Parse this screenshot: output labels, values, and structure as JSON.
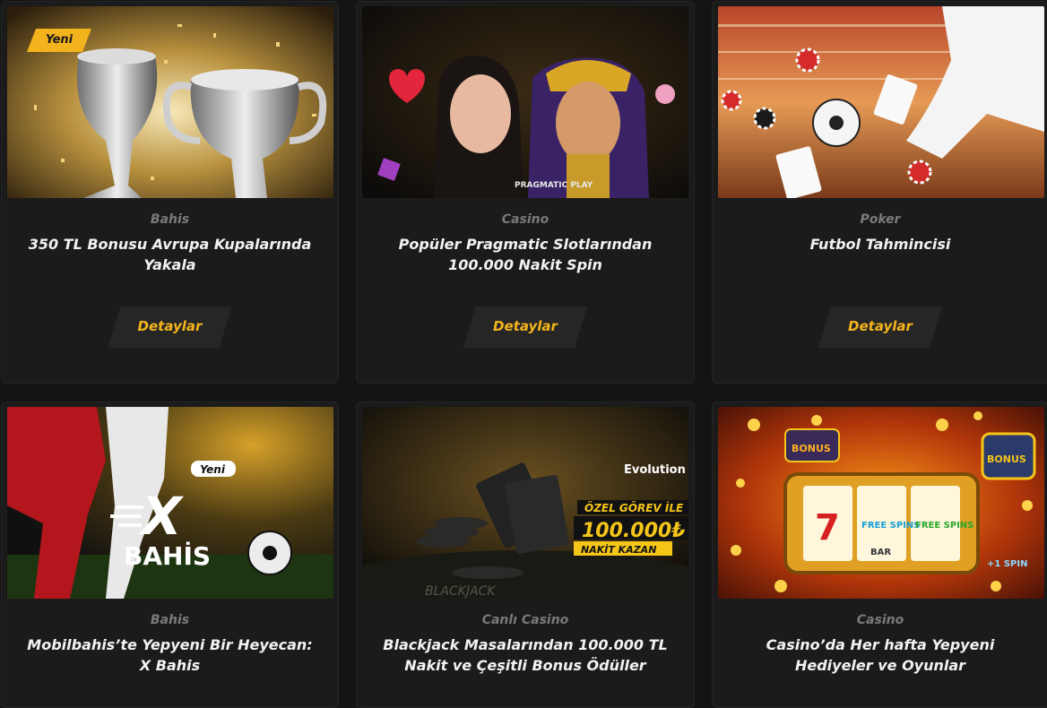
{
  "cards": [
    {
      "category": "Bahis",
      "title": "350 TL Bonusu Avrupa Kupalarında Yakala",
      "button": "Detaylar",
      "badge": "Yeni"
    },
    {
      "category": "Casino",
      "title": "Popüler Pragmatic Slotlarından 100.000 Nakit Spin",
      "button": "Detaylar",
      "image_text": "PRAGMATIC PLAY"
    },
    {
      "category": "Poker",
      "title": "Futbol Tahmincisi",
      "button": "Detaylar"
    },
    {
      "category": "Bahis",
      "title": "Mobilbahis’te Yepyeni Bir Heyecan: X Bahis",
      "image_badge": "Yeni",
      "image_text_x": "X",
      "image_text_bahis": "BAHİS"
    },
    {
      "category": "Canlı Casino",
      "title": "Blackjack Masalarından 100.000 TL Nakit ve Çeşitli Bonus Ödüller",
      "image_brand": "Evolution",
      "image_line1": "ÖZEL GÖREV İLE",
      "image_line2": "100.000₺",
      "image_line3": "NAKİT KAZAN",
      "image_table": "BLACKJACK"
    },
    {
      "category": "Casino",
      "title": "Casino’da Her hafta Yepyeni Hediyeler ve Oyunlar",
      "image_bonus": "BONUS",
      "image_free_spins": "FREE SPINS",
      "image_seven": "7",
      "image_bar": "BAR",
      "image_spin": "+1 SPIN"
    }
  ],
  "colors": {
    "accent": "#f5b41a",
    "background": "#141414",
    "card": "#1b1b1b",
    "button": "#262626",
    "category": "#7a7a7a",
    "title": "#f2f2f2"
  }
}
